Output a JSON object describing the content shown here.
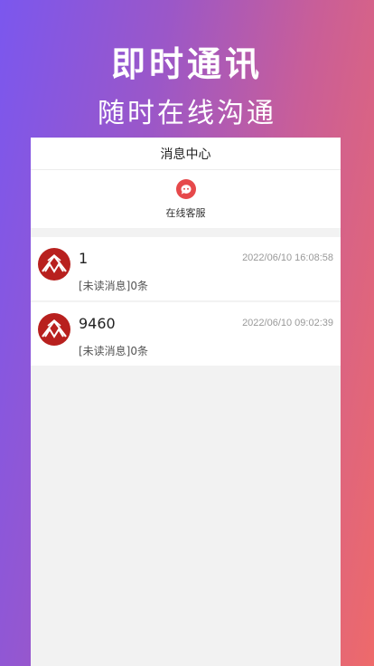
{
  "hero": {
    "title": "即时通讯",
    "subtitle": "随时在线沟通"
  },
  "app": {
    "header_title": "消息中心",
    "service": {
      "icon": "chat-bubble-icon",
      "label": "在线客服",
      "color": "#e6494b"
    },
    "conversations": [
      {
        "name": "1",
        "time": "2022/06/10 16:08:58",
        "preview": "[未读消息]0条",
        "avatar": "red-triangle-logo"
      },
      {
        "name": "9460",
        "time": "2022/06/10 09:02:39",
        "preview": "[未读消息]0条",
        "avatar": "red-triangle-logo"
      }
    ]
  },
  "colors": {
    "gradient_start": "#7b57ee",
    "gradient_end": "#ee6a6a",
    "avatar_red": "#b8201e"
  }
}
